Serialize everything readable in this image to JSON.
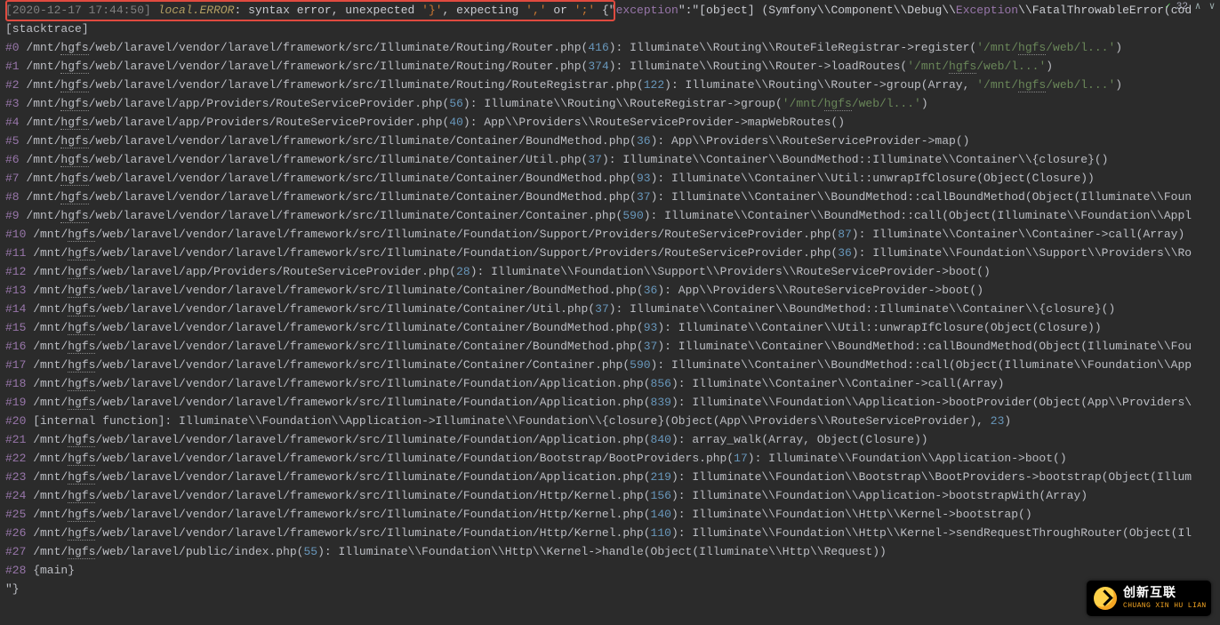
{
  "topbar": {
    "check": "✓",
    "count": "32",
    "up": "∧",
    "down": "∨"
  },
  "first": {
    "ts_open": "[",
    "ts": "2020-12-17 17:44:50",
    "ts_close": "] ",
    "channel": "local.ERROR",
    "colon": ": ",
    "msg1": "syntax error, unexpected ",
    "q1": "'}'",
    "msg2": ", expecting ",
    "q2": "','",
    "msg3": " or ",
    "q3": "';'",
    "post": " {\"",
    "exkey": "exception",
    "post2": "\":\"[object] (Symfony\\\\Component\\\\Debug\\\\",
    "excls": "Exception",
    "post3": "\\\\FatalThrowableError(cod"
  },
  "stackheader": "[stacktrace]",
  "hgfs": "hgfs",
  "lines": [
    {
      "i": "#0",
      "pre": " /mnt/",
      "mid": "/web/laravel/vendor/laravel/framework/src/Illuminate/Routing/Router.php(",
      "n": "416",
      "post": "): Illuminate\\\\Routing\\\\RouteFileRegistrar->register(",
      "str": "'/mnt/hgfs/web/l...'",
      "tail": ")"
    },
    {
      "i": "#1",
      "pre": " /mnt/",
      "mid": "/web/laravel/vendor/laravel/framework/src/Illuminate/Routing/Router.php(",
      "n": "374",
      "post": "): Illuminate\\\\Routing\\\\Router->loadRoutes(",
      "str": "'/mnt/hgfs/web/l...'",
      "tail": ")"
    },
    {
      "i": "#2",
      "pre": " /mnt/",
      "mid": "/web/laravel/vendor/laravel/framework/src/Illuminate/Routing/RouteRegistrar.php(",
      "n": "122",
      "post": "): Illuminate\\\\Routing\\\\Router->group(Array, ",
      "str": "'/mnt/hgfs/web/l...'",
      "tail": ")"
    },
    {
      "i": "#3",
      "pre": " /mnt/",
      "mid": "/web/laravel/app/Providers/RouteServiceProvider.php(",
      "n": "56",
      "post": "): Illuminate\\\\Routing\\\\RouteRegistrar->group(",
      "str": "'/mnt/hgfs/web/l...'",
      "tail": ")"
    },
    {
      "i": "#4",
      "pre": " /mnt/",
      "mid": "/web/laravel/app/Providers/RouteServiceProvider.php(",
      "n": "40",
      "post": "): App\\\\Providers\\\\RouteServiceProvider->mapWebRoutes()",
      "str": "",
      "tail": ""
    },
    {
      "i": "#5",
      "pre": " /mnt/",
      "mid": "/web/laravel/vendor/laravel/framework/src/Illuminate/Container/BoundMethod.php(",
      "n": "36",
      "post": "): App\\\\Providers\\\\RouteServiceProvider->map()",
      "str": "",
      "tail": ""
    },
    {
      "i": "#6",
      "pre": " /mnt/",
      "mid": "/web/laravel/vendor/laravel/framework/src/Illuminate/Container/Util.php(",
      "n": "37",
      "post": "): Illuminate\\\\Container\\\\BoundMethod::Illuminate\\\\Container\\\\{closure}()",
      "str": "",
      "tail": ""
    },
    {
      "i": "#7",
      "pre": " /mnt/",
      "mid": "/web/laravel/vendor/laravel/framework/src/Illuminate/Container/BoundMethod.php(",
      "n": "93",
      "post": "): Illuminate\\\\Container\\\\Util::unwrapIfClosure(Object(Closure))",
      "str": "",
      "tail": ""
    },
    {
      "i": "#8",
      "pre": " /mnt/",
      "mid": "/web/laravel/vendor/laravel/framework/src/Illuminate/Container/BoundMethod.php(",
      "n": "37",
      "post": "): Illuminate\\\\Container\\\\BoundMethod::callBoundMethod(Object(Illuminate\\\\Foun",
      "str": "",
      "tail": ""
    },
    {
      "i": "#9",
      "pre": " /mnt/",
      "mid": "/web/laravel/vendor/laravel/framework/src/Illuminate/Container/Container.php(",
      "n": "590",
      "post": "): Illuminate\\\\Container\\\\BoundMethod::call(Object(Illuminate\\\\Foundation\\\\Appl",
      "str": "",
      "tail": ""
    },
    {
      "i": "#10",
      "pre": " /mnt/",
      "mid": "/web/laravel/vendor/laravel/framework/src/Illuminate/Foundation/Support/Providers/RouteServiceProvider.php(",
      "n": "87",
      "post": "): Illuminate\\\\Container\\\\Container->call(Array)",
      "str": "",
      "tail": ""
    },
    {
      "i": "#11",
      "pre": " /mnt/",
      "mid": "/web/laravel/vendor/laravel/framework/src/Illuminate/Foundation/Support/Providers/RouteServiceProvider.php(",
      "n": "36",
      "post": "): Illuminate\\\\Foundation\\\\Support\\\\Providers\\\\Ro",
      "str": "",
      "tail": ""
    },
    {
      "i": "#12",
      "pre": " /mnt/",
      "mid": "/web/laravel/app/Providers/RouteServiceProvider.php(",
      "n": "28",
      "post": "): Illuminate\\\\Foundation\\\\Support\\\\Providers\\\\RouteServiceProvider->boot()",
      "str": "",
      "tail": ""
    },
    {
      "i": "#13",
      "pre": " /mnt/",
      "mid": "/web/laravel/vendor/laravel/framework/src/Illuminate/Container/BoundMethod.php(",
      "n": "36",
      "post": "): App\\\\Providers\\\\RouteServiceProvider->boot()",
      "str": "",
      "tail": ""
    },
    {
      "i": "#14",
      "pre": " /mnt/",
      "mid": "/web/laravel/vendor/laravel/framework/src/Illuminate/Container/Util.php(",
      "n": "37",
      "post": "): Illuminate\\\\Container\\\\BoundMethod::Illuminate\\\\Container\\\\{closure}()",
      "str": "",
      "tail": ""
    },
    {
      "i": "#15",
      "pre": " /mnt/",
      "mid": "/web/laravel/vendor/laravel/framework/src/Illuminate/Container/BoundMethod.php(",
      "n": "93",
      "post": "): Illuminate\\\\Container\\\\Util::unwrapIfClosure(Object(Closure))",
      "str": "",
      "tail": ""
    },
    {
      "i": "#16",
      "pre": " /mnt/",
      "mid": "/web/laravel/vendor/laravel/framework/src/Illuminate/Container/BoundMethod.php(",
      "n": "37",
      "post": "): Illuminate\\\\Container\\\\BoundMethod::callBoundMethod(Object(Illuminate\\\\Fou",
      "str": "",
      "tail": ""
    },
    {
      "i": "#17",
      "pre": " /mnt/",
      "mid": "/web/laravel/vendor/laravel/framework/src/Illuminate/Container/Container.php(",
      "n": "590",
      "post": "): Illuminate\\\\Container\\\\BoundMethod::call(Object(Illuminate\\\\Foundation\\\\App",
      "str": "",
      "tail": ""
    },
    {
      "i": "#18",
      "pre": " /mnt/",
      "mid": "/web/laravel/vendor/laravel/framework/src/Illuminate/Foundation/Application.php(",
      "n": "856",
      "post": "): Illuminate\\\\Container\\\\Container->call(Array)",
      "str": "",
      "tail": ""
    },
    {
      "i": "#19",
      "pre": " /mnt/",
      "mid": "/web/laravel/vendor/laravel/framework/src/Illuminate/Foundation/Application.php(",
      "n": "839",
      "post": "): Illuminate\\\\Foundation\\\\Application->bootProvider(Object(App\\\\Providers\\",
      "str": "",
      "tail": ""
    },
    {
      "i": "#20",
      "pre": " [internal function]: Illuminate\\\\Foundation\\\\Application->Illuminate\\\\Foundation\\\\{closure}(Object(App\\\\Providers\\\\RouteServiceProvider), ",
      "mid": "",
      "n": "23",
      "post": ")",
      "str": "",
      "tail": "",
      "nohg": true
    },
    {
      "i": "#21",
      "pre": " /mnt/",
      "mid": "/web/laravel/vendor/laravel/framework/src/Illuminate/Foundation/Application.php(",
      "n": "840",
      "post": "): array_walk(Array, Object(Closure))",
      "str": "",
      "tail": ""
    },
    {
      "i": "#22",
      "pre": " /mnt/",
      "mid": "/web/laravel/vendor/laravel/framework/src/Illuminate/Foundation/Bootstrap/BootProviders.php(",
      "n": "17",
      "post": "): Illuminate\\\\Foundation\\\\Application->boot()",
      "str": "",
      "tail": ""
    },
    {
      "i": "#23",
      "pre": " /mnt/",
      "mid": "/web/laravel/vendor/laravel/framework/src/Illuminate/Foundation/Application.php(",
      "n": "219",
      "post": "): Illuminate\\\\Foundation\\\\Bootstrap\\\\BootProviders->bootstrap(Object(Illum",
      "str": "",
      "tail": ""
    },
    {
      "i": "#24",
      "pre": " /mnt/",
      "mid": "/web/laravel/vendor/laravel/framework/src/Illuminate/Foundation/Http/Kernel.php(",
      "n": "156",
      "post": "): Illuminate\\\\Foundation\\\\Application->bootstrapWith(Array)",
      "str": "",
      "tail": ""
    },
    {
      "i": "#25",
      "pre": " /mnt/",
      "mid": "/web/laravel/vendor/laravel/framework/src/Illuminate/Foundation/Http/Kernel.php(",
      "n": "140",
      "post": "): Illuminate\\\\Foundation\\\\Http\\\\Kernel->bootstrap()",
      "str": "",
      "tail": ""
    },
    {
      "i": "#26",
      "pre": " /mnt/",
      "mid": "/web/laravel/vendor/laravel/framework/src/Illuminate/Foundation/Http/Kernel.php(",
      "n": "110",
      "post": "): Illuminate\\\\Foundation\\\\Http\\\\Kernel->sendRequestThroughRouter(Object(Il",
      "str": "",
      "tail": ""
    },
    {
      "i": "#27",
      "pre": " /mnt/",
      "mid": "/web/laravel/public/index.php(",
      "n": "55",
      "post": "): Illuminate\\\\Foundation\\\\Http\\\\Kernel->handle(Object(Illuminate\\\\Http\\\\Request))",
      "str": "",
      "tail": ""
    },
    {
      "i": "#28",
      "pre": " {main}",
      "mid": "",
      "n": "",
      "post": "",
      "str": "",
      "tail": "",
      "nohg": true
    }
  ],
  "closer": "\"}",
  "brand": {
    "cn": "创新互联",
    "py": "CHUANG XIN HU LIAN"
  }
}
